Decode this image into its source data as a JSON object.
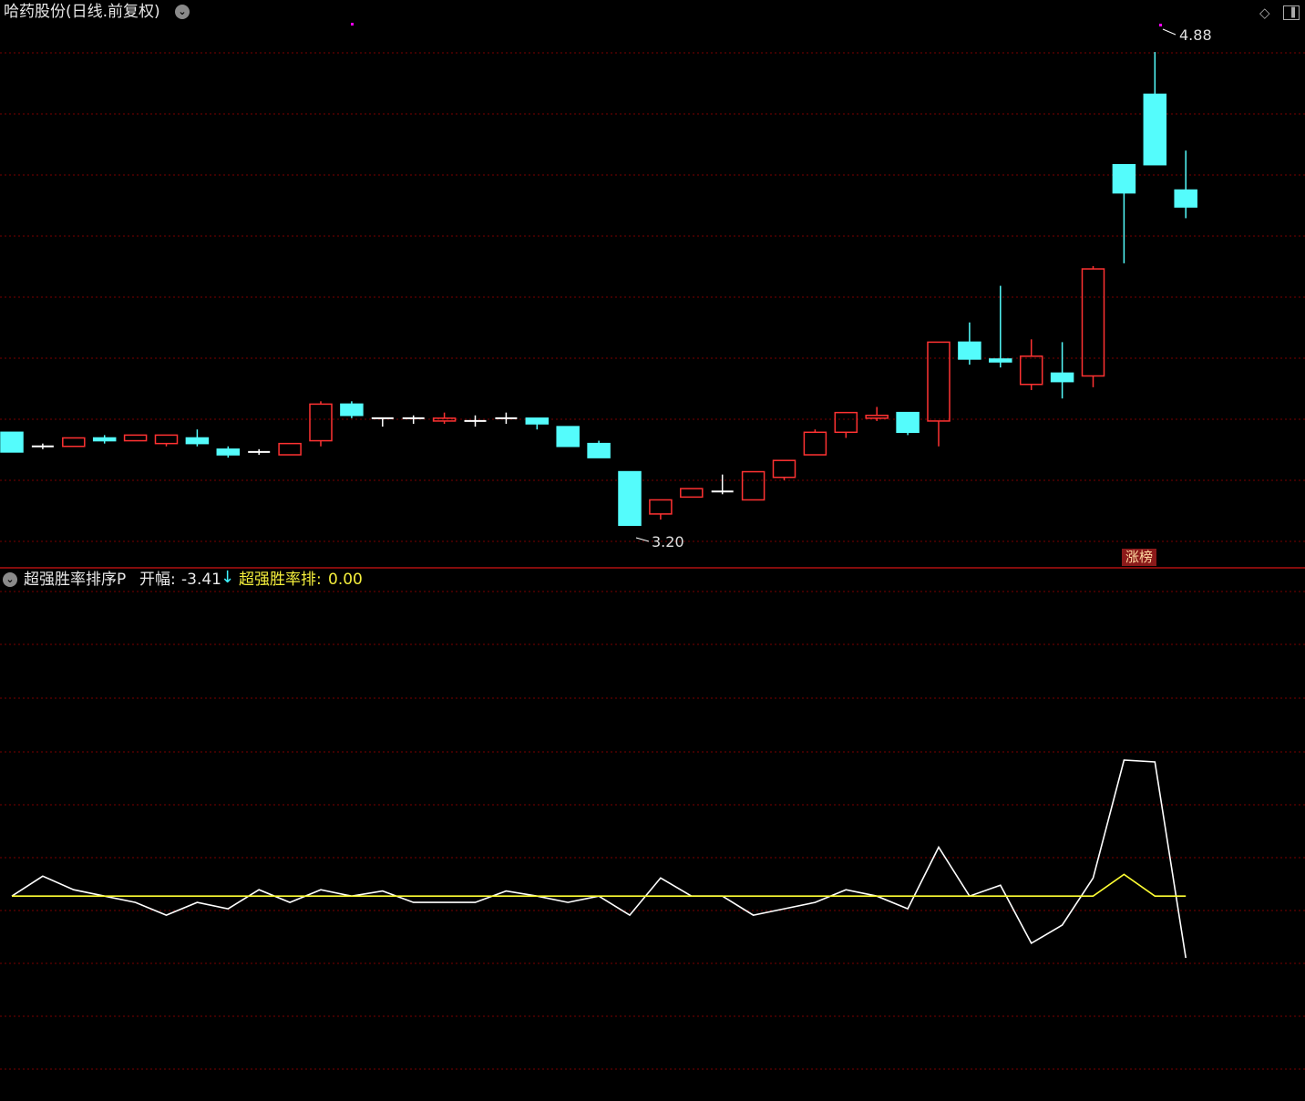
{
  "header": {
    "title": "哈药股份(日线.前复权)",
    "menu_icon": "chevron-down-icon",
    "toolbar_icons": [
      "diamond-icon",
      "window-toggle-icon"
    ]
  },
  "price_labels": {
    "high": "4.88",
    "low": "3.20"
  },
  "tag": "涨榜",
  "indicator": {
    "name": "超强胜率排序P",
    "open_label": "开幅:",
    "open_value": "-3.41",
    "open_direction": "down",
    "line2_name": "超强胜率排:",
    "line2_value": "0.00"
  },
  "colors": {
    "background": "#000000",
    "up_candle": "#ff3232",
    "down_candle": "#54fcfc",
    "doji": "#ffffff",
    "grid": "#7a0000",
    "divider": "#b01010",
    "indicator_line": "#ffffff",
    "indicator_line2": "#ffff33",
    "marker": "#ff00ff"
  },
  "chart_data": [
    {
      "type": "candlestick",
      "title": "哈药股份(日线.前复权)",
      "ylim": [
        3.12,
        5.0
      ],
      "candles": [
        {
          "o": 3.53,
          "h": 3.53,
          "l": 3.46,
          "c": 3.46
        },
        {
          "o": 3.48,
          "h": 3.49,
          "l": 3.47,
          "c": 3.48
        },
        {
          "o": 3.48,
          "h": 3.51,
          "l": 3.48,
          "c": 3.51
        },
        {
          "o": 3.51,
          "h": 3.52,
          "l": 3.49,
          "c": 3.5
        },
        {
          "o": 3.5,
          "h": 3.52,
          "l": 3.5,
          "c": 3.52
        },
        {
          "o": 3.49,
          "h": 3.52,
          "l": 3.48,
          "c": 3.52
        },
        {
          "o": 3.51,
          "h": 3.54,
          "l": 3.48,
          "c": 3.49
        },
        {
          "o": 3.47,
          "h": 3.48,
          "l": 3.44,
          "c": 3.45
        },
        {
          "o": 3.46,
          "h": 3.47,
          "l": 3.45,
          "c": 3.46
        },
        {
          "o": 3.45,
          "h": 3.49,
          "l": 3.45,
          "c": 3.49
        },
        {
          "o": 3.5,
          "h": 3.64,
          "l": 3.48,
          "c": 3.63
        },
        {
          "o": 3.63,
          "h": 3.64,
          "l": 3.58,
          "c": 3.59
        },
        {
          "o": 3.58,
          "h": 3.58,
          "l": 3.55,
          "c": 3.58
        },
        {
          "o": 3.58,
          "h": 3.59,
          "l": 3.56,
          "c": 3.58
        },
        {
          "o": 3.57,
          "h": 3.6,
          "l": 3.56,
          "c": 3.58
        },
        {
          "o": 3.57,
          "h": 3.59,
          "l": 3.55,
          "c": 3.57
        },
        {
          "o": 3.58,
          "h": 3.6,
          "l": 3.56,
          "c": 3.58
        },
        {
          "o": 3.58,
          "h": 3.58,
          "l": 3.54,
          "c": 3.56
        },
        {
          "o": 3.55,
          "h": 3.55,
          "l": 3.48,
          "c": 3.48
        },
        {
          "o": 3.49,
          "h": 3.5,
          "l": 3.44,
          "c": 3.44
        },
        {
          "o": 3.39,
          "h": 3.39,
          "l": 3.2,
          "c": 3.2
        },
        {
          "o": 3.24,
          "h": 3.29,
          "l": 3.22,
          "c": 3.29
        },
        {
          "o": 3.3,
          "h": 3.33,
          "l": 3.3,
          "c": 3.33
        },
        {
          "o": 3.32,
          "h": 3.38,
          "l": 3.31,
          "c": 3.32
        },
        {
          "o": 3.29,
          "h": 3.39,
          "l": 3.29,
          "c": 3.39
        },
        {
          "o": 3.37,
          "h": 3.43,
          "l": 3.36,
          "c": 3.43
        },
        {
          "o": 3.45,
          "h": 3.54,
          "l": 3.45,
          "c": 3.53
        },
        {
          "o": 3.53,
          "h": 3.6,
          "l": 3.51,
          "c": 3.6
        },
        {
          "o": 3.58,
          "h": 3.62,
          "l": 3.57,
          "c": 3.59
        },
        {
          "o": 3.6,
          "h": 3.6,
          "l": 3.52,
          "c": 3.53
        },
        {
          "o": 3.57,
          "h": 3.85,
          "l": 3.48,
          "c": 3.85
        },
        {
          "o": 3.85,
          "h": 3.92,
          "l": 3.77,
          "c": 3.79
        },
        {
          "o": 3.79,
          "h": 4.05,
          "l": 3.76,
          "c": 3.78
        },
        {
          "o": 3.7,
          "h": 3.86,
          "l": 3.68,
          "c": 3.8
        },
        {
          "o": 3.74,
          "h": 3.85,
          "l": 3.65,
          "c": 3.71
        },
        {
          "o": 3.73,
          "h": 4.12,
          "l": 3.69,
          "c": 4.11
        },
        {
          "o": 4.48,
          "h": 4.48,
          "l": 4.13,
          "c": 4.38
        },
        {
          "o": 4.73,
          "h": 4.88,
          "l": 4.48,
          "c": 4.48
        },
        {
          "o": 4.39,
          "h": 4.53,
          "l": 4.29,
          "c": 4.33
        }
      ]
    },
    {
      "type": "line",
      "title": "超强胜率排序P",
      "ylim": [
        -10.9,
        17
      ],
      "series": [
        {
          "name": "开幅",
          "values": [
            0,
            1.1,
            0.35,
            0,
            -0.35,
            -1.05,
            -0.35,
            -0.7,
            0.35,
            -0.35,
            0.35,
            0,
            0.28,
            -0.35,
            -0.35,
            -0.35,
            0.28,
            0,
            -0.35,
            0,
            -1.05,
            1.0,
            0,
            0,
            -1.05,
            -0.7,
            -0.35,
            0.35,
            0,
            -0.7,
            2.7,
            0,
            0.6,
            -2.6,
            -1.6,
            1.0,
            7.5,
            7.4,
            -3.41
          ]
        },
        {
          "name": "超强胜率排",
          "values": [
            0,
            0,
            0,
            0,
            0,
            0,
            0,
            0,
            0,
            0,
            0,
            0,
            0,
            0,
            0,
            0,
            0,
            0,
            0,
            0,
            0,
            0,
            0,
            0,
            0,
            0,
            0,
            0,
            0,
            0,
            0,
            0,
            0,
            0,
            0,
            0,
            1.2,
            0,
            0
          ]
        }
      ]
    }
  ]
}
